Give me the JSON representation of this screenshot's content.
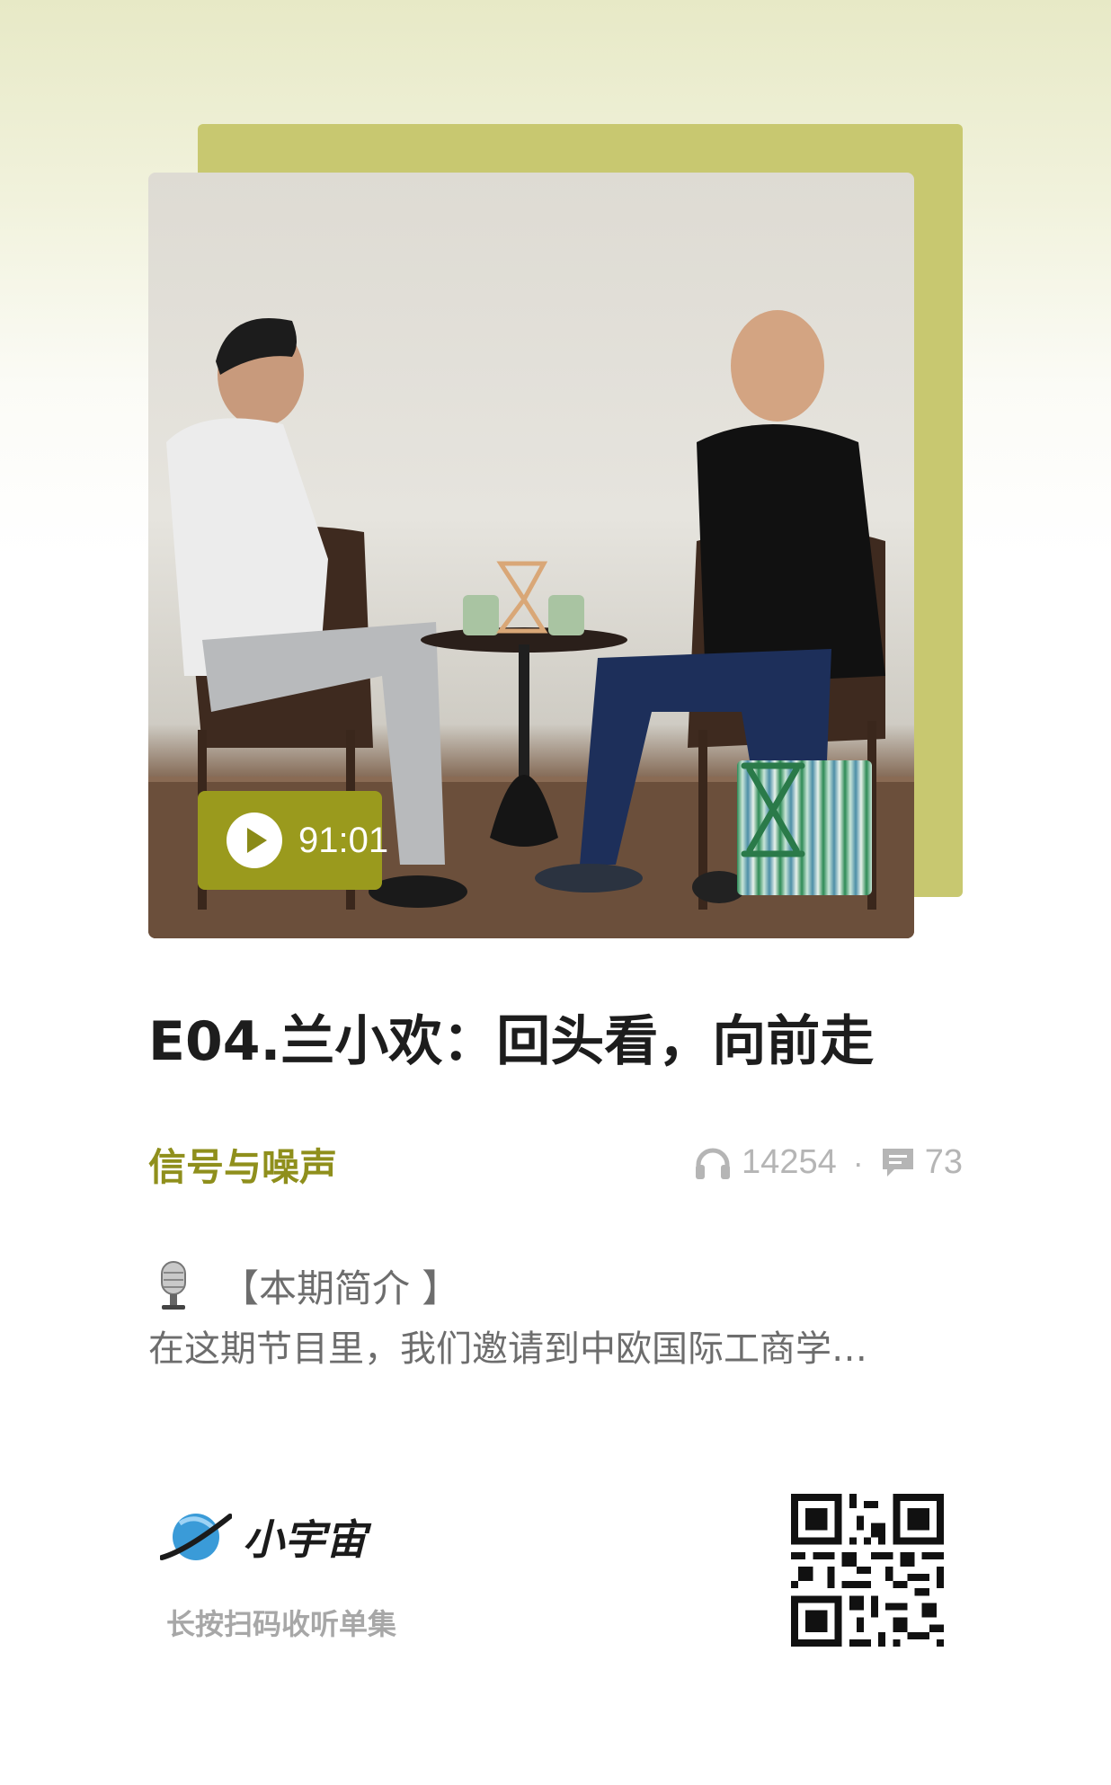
{
  "cover": {
    "duration": "91:01"
  },
  "episode": {
    "title": "E04.兰小欢：回头看，向前走"
  },
  "podcast": {
    "name": "信号与噪声",
    "play_count": "14254",
    "separator": "·",
    "comment_count": "73"
  },
  "intro": {
    "heading": "【本期简介 】",
    "body": "在这期节目里，我们邀请到中欧国际工商学…"
  },
  "footer": {
    "brand": "小宇宙",
    "scan_hint": "长按扫码收听单集"
  },
  "colors": {
    "accent": "#8f8f1c",
    "badge": "#9a9a1d",
    "back_card": "#c8c870",
    "title": "#1d1d1d",
    "muted": "#b5b5b5"
  },
  "icons": {
    "play": "play-icon",
    "listen": "headphones-icon",
    "comment": "comment-icon",
    "microphone": "microphone-icon",
    "hourglass": "hourglass-logo-icon",
    "brand": "planet-icon"
  }
}
